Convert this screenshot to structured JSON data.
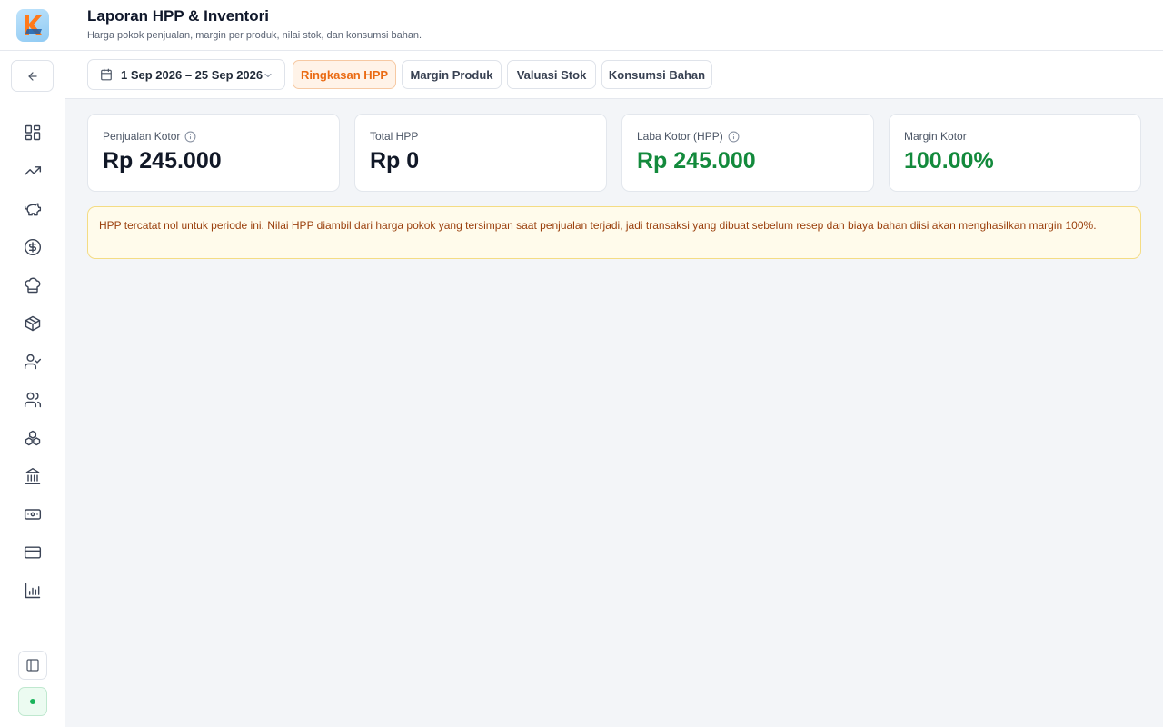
{
  "app": {
    "logo_letter": "K",
    "accent_color": "#ea6a12",
    "success_color": "#138a3c"
  },
  "sidebar": {
    "back_icon": "arrow-left-icon",
    "items": [
      {
        "name": "dashboard",
        "icon": "dashboard-icon"
      },
      {
        "name": "sales",
        "icon": "trending-up-icon"
      },
      {
        "name": "savings",
        "icon": "piggy-bank-icon"
      },
      {
        "name": "finance",
        "icon": "dollar-circle-icon"
      },
      {
        "name": "recipes",
        "icon": "chef-hat-icon"
      },
      {
        "name": "inventory",
        "icon": "package-icon"
      },
      {
        "name": "staff",
        "icon": "user-check-icon"
      },
      {
        "name": "customers",
        "icon": "users-icon"
      },
      {
        "name": "ingredients",
        "icon": "boxes-icon"
      },
      {
        "name": "bank",
        "icon": "landmark-icon"
      },
      {
        "name": "cash",
        "icon": "banknote-icon"
      },
      {
        "name": "payments",
        "icon": "credit-card-icon"
      },
      {
        "name": "reports",
        "icon": "bar-chart-icon"
      }
    ],
    "collapse_icon": "panel-left-icon"
  },
  "header": {
    "title": "Laporan HPP & Inventori",
    "subtitle": "Harga pokok penjualan, margin per produk, nilai stok, dan konsumsi bahan."
  },
  "toolbar": {
    "date_range": "1 Sep 2026 – 25 Sep 2026",
    "tabs": [
      {
        "label": "Ringkasan HPP",
        "active": true
      },
      {
        "label": "Margin Produk",
        "active": false
      },
      {
        "label": "Valuasi Stok",
        "active": false
      },
      {
        "label": "Konsumsi Bahan",
        "active": false
      }
    ]
  },
  "summary": {
    "cards": [
      {
        "label": "Penjualan Kotor",
        "value": "Rp 245.000",
        "has_info": true
      },
      {
        "label": "Total HPP",
        "value": "Rp 0",
        "has_info": false
      },
      {
        "label": "Laba Kotor (HPP)",
        "value": "Rp 245.000",
        "has_info": true
      },
      {
        "label": "Margin Kotor",
        "value": "100.00%",
        "has_info": false
      }
    ]
  },
  "notice": {
    "text": "HPP tercatat nol untuk periode ini. Nilai HPP diambil dari harga pokok yang tersimpan saat penjualan terjadi, jadi transaksi yang dibuat sebelum resep dan biaya bahan diisi akan menghasilkan margin 100%."
  }
}
